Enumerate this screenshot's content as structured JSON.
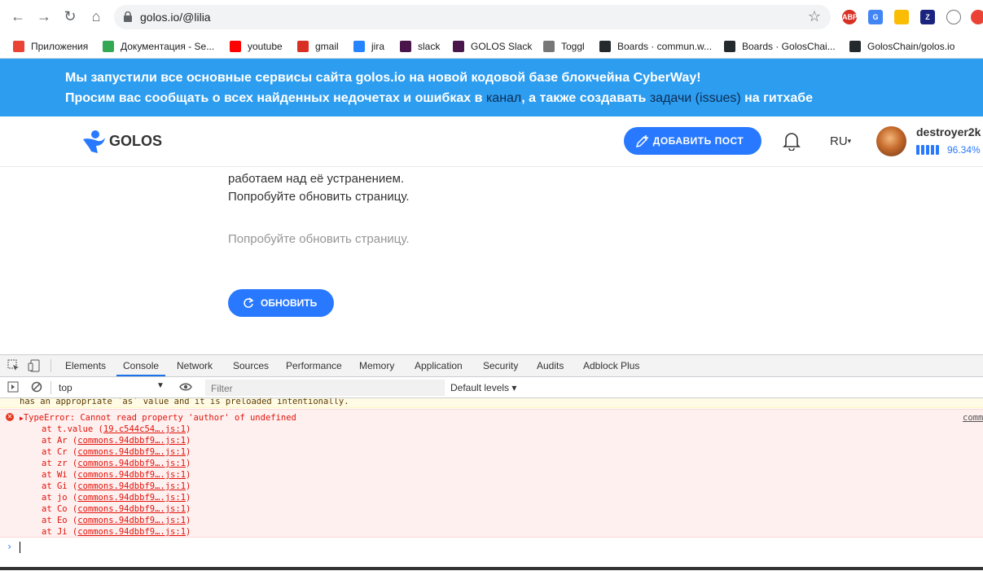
{
  "browser": {
    "url": "golos.io/@lilia",
    "bookmarks": [
      {
        "label": "Приложения",
        "color": "#ea4335"
      },
      {
        "label": "Документация - Se...",
        "color": "#34a853"
      },
      {
        "label": "youtube",
        "color": "#ff0000"
      },
      {
        "label": "gmail",
        "color": "#d93025"
      },
      {
        "label": "jira",
        "color": "#2684ff"
      },
      {
        "label": "slack",
        "color": "#4a154b"
      },
      {
        "label": "GOLOS Slack",
        "color": "#4a154b"
      },
      {
        "label": "Toggl",
        "color": "#777777"
      },
      {
        "label": "Boards · commun.w...",
        "color": "#24292e"
      },
      {
        "label": "Boards · GolosChai...",
        "color": "#24292e"
      },
      {
        "label": "GolosChain/golos.io",
        "color": "#24292e"
      }
    ],
    "extensions": [
      "ABP",
      "G",
      "",
      "Z",
      ""
    ]
  },
  "announcement": {
    "line1": "Мы запустили все основные сервисы сайта golos.io на новой кодовой базе блокчейна CyberWay!",
    "line2_a": "Просим вас сообщать о всех найденных недочетах и ошибках в",
    "line2_link1": "канал",
    "line2_b": ", а также создавать",
    "line2_link2": "задачи (issues)",
    "line2_c": "на гитхабе"
  },
  "header": {
    "logo": "GOLOS",
    "add_post": "ДОБАВИТЬ ПОСТ",
    "lang": "RU",
    "username": "destroyer2k",
    "power": "96.34%"
  },
  "content": {
    "line1": "работаем над её устранением.",
    "line2": "Попробуйте обновить страницу.",
    "hint": "Попробуйте обновить страницу.",
    "refresh": "ОБНОВИТЬ"
  },
  "devtools": {
    "tabs": [
      "Elements",
      "Console",
      "Network",
      "Sources",
      "Performance",
      "Memory",
      "Application",
      "Security",
      "Audits",
      "Adblock Plus"
    ],
    "active_tab": "Console",
    "context": "top",
    "filter_placeholder": "Filter",
    "levels": "Default levels ▾",
    "warn_text": "has an appropriate `as` value and it is preloaded intentionally.",
    "error": "TypeError: Cannot read property 'author' of undefined",
    "error_source": "comm",
    "frames": [
      {
        "fn": "at t.value",
        "src": "19.c544c54….js:1"
      },
      {
        "fn": "at Ar",
        "src": "commons.94dbbf9….js:1"
      },
      {
        "fn": "at Cr",
        "src": "commons.94dbbf9….js:1"
      },
      {
        "fn": "at zr",
        "src": "commons.94dbbf9….js:1"
      },
      {
        "fn": "at Wi",
        "src": "commons.94dbbf9….js:1"
      },
      {
        "fn": "at Gi",
        "src": "commons.94dbbf9….js:1"
      },
      {
        "fn": "at jo",
        "src": "commons.94dbbf9….js:1"
      },
      {
        "fn": "at Co",
        "src": "commons.94dbbf9….js:1"
      },
      {
        "fn": "at Eo",
        "src": "commons.94dbbf9….js:1"
      },
      {
        "fn": "at Ji",
        "src": "commons.94dbbf9….js:1"
      }
    ]
  }
}
